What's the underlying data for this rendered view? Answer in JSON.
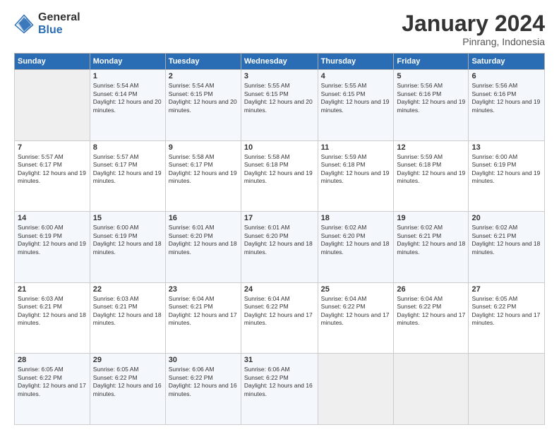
{
  "header": {
    "logo_general": "General",
    "logo_blue": "Blue",
    "month_year": "January 2024",
    "location": "Pinrang, Indonesia"
  },
  "columns": [
    "Sunday",
    "Monday",
    "Tuesday",
    "Wednesday",
    "Thursday",
    "Friday",
    "Saturday"
  ],
  "weeks": [
    [
      {
        "day": "",
        "sunrise": "",
        "sunset": "",
        "daylight": ""
      },
      {
        "day": "1",
        "sunrise": "Sunrise: 5:54 AM",
        "sunset": "Sunset: 6:14 PM",
        "daylight": "Daylight: 12 hours and 20 minutes."
      },
      {
        "day": "2",
        "sunrise": "Sunrise: 5:54 AM",
        "sunset": "Sunset: 6:15 PM",
        "daylight": "Daylight: 12 hours and 20 minutes."
      },
      {
        "day": "3",
        "sunrise": "Sunrise: 5:55 AM",
        "sunset": "Sunset: 6:15 PM",
        "daylight": "Daylight: 12 hours and 20 minutes."
      },
      {
        "day": "4",
        "sunrise": "Sunrise: 5:55 AM",
        "sunset": "Sunset: 6:15 PM",
        "daylight": "Daylight: 12 hours and 19 minutes."
      },
      {
        "day": "5",
        "sunrise": "Sunrise: 5:56 AM",
        "sunset": "Sunset: 6:16 PM",
        "daylight": "Daylight: 12 hours and 19 minutes."
      },
      {
        "day": "6",
        "sunrise": "Sunrise: 5:56 AM",
        "sunset": "Sunset: 6:16 PM",
        "daylight": "Daylight: 12 hours and 19 minutes."
      }
    ],
    [
      {
        "day": "7",
        "sunrise": "Sunrise: 5:57 AM",
        "sunset": "Sunset: 6:17 PM",
        "daylight": "Daylight: 12 hours and 19 minutes."
      },
      {
        "day": "8",
        "sunrise": "Sunrise: 5:57 AM",
        "sunset": "Sunset: 6:17 PM",
        "daylight": "Daylight: 12 hours and 19 minutes."
      },
      {
        "day": "9",
        "sunrise": "Sunrise: 5:58 AM",
        "sunset": "Sunset: 6:17 PM",
        "daylight": "Daylight: 12 hours and 19 minutes."
      },
      {
        "day": "10",
        "sunrise": "Sunrise: 5:58 AM",
        "sunset": "Sunset: 6:18 PM",
        "daylight": "Daylight: 12 hours and 19 minutes."
      },
      {
        "day": "11",
        "sunrise": "Sunrise: 5:59 AM",
        "sunset": "Sunset: 6:18 PM",
        "daylight": "Daylight: 12 hours and 19 minutes."
      },
      {
        "day": "12",
        "sunrise": "Sunrise: 5:59 AM",
        "sunset": "Sunset: 6:18 PM",
        "daylight": "Daylight: 12 hours and 19 minutes."
      },
      {
        "day": "13",
        "sunrise": "Sunrise: 6:00 AM",
        "sunset": "Sunset: 6:19 PM",
        "daylight": "Daylight: 12 hours and 19 minutes."
      }
    ],
    [
      {
        "day": "14",
        "sunrise": "Sunrise: 6:00 AM",
        "sunset": "Sunset: 6:19 PM",
        "daylight": "Daylight: 12 hours and 19 minutes."
      },
      {
        "day": "15",
        "sunrise": "Sunrise: 6:00 AM",
        "sunset": "Sunset: 6:19 PM",
        "daylight": "Daylight: 12 hours and 18 minutes."
      },
      {
        "day": "16",
        "sunrise": "Sunrise: 6:01 AM",
        "sunset": "Sunset: 6:20 PM",
        "daylight": "Daylight: 12 hours and 18 minutes."
      },
      {
        "day": "17",
        "sunrise": "Sunrise: 6:01 AM",
        "sunset": "Sunset: 6:20 PM",
        "daylight": "Daylight: 12 hours and 18 minutes."
      },
      {
        "day": "18",
        "sunrise": "Sunrise: 6:02 AM",
        "sunset": "Sunset: 6:20 PM",
        "daylight": "Daylight: 12 hours and 18 minutes."
      },
      {
        "day": "19",
        "sunrise": "Sunrise: 6:02 AM",
        "sunset": "Sunset: 6:21 PM",
        "daylight": "Daylight: 12 hours and 18 minutes."
      },
      {
        "day": "20",
        "sunrise": "Sunrise: 6:02 AM",
        "sunset": "Sunset: 6:21 PM",
        "daylight": "Daylight: 12 hours and 18 minutes."
      }
    ],
    [
      {
        "day": "21",
        "sunrise": "Sunrise: 6:03 AM",
        "sunset": "Sunset: 6:21 PM",
        "daylight": "Daylight: 12 hours and 18 minutes."
      },
      {
        "day": "22",
        "sunrise": "Sunrise: 6:03 AM",
        "sunset": "Sunset: 6:21 PM",
        "daylight": "Daylight: 12 hours and 18 minutes."
      },
      {
        "day": "23",
        "sunrise": "Sunrise: 6:04 AM",
        "sunset": "Sunset: 6:21 PM",
        "daylight": "Daylight: 12 hours and 17 minutes."
      },
      {
        "day": "24",
        "sunrise": "Sunrise: 6:04 AM",
        "sunset": "Sunset: 6:22 PM",
        "daylight": "Daylight: 12 hours and 17 minutes."
      },
      {
        "day": "25",
        "sunrise": "Sunrise: 6:04 AM",
        "sunset": "Sunset: 6:22 PM",
        "daylight": "Daylight: 12 hours and 17 minutes."
      },
      {
        "day": "26",
        "sunrise": "Sunrise: 6:04 AM",
        "sunset": "Sunset: 6:22 PM",
        "daylight": "Daylight: 12 hours and 17 minutes."
      },
      {
        "day": "27",
        "sunrise": "Sunrise: 6:05 AM",
        "sunset": "Sunset: 6:22 PM",
        "daylight": "Daylight: 12 hours and 17 minutes."
      }
    ],
    [
      {
        "day": "28",
        "sunrise": "Sunrise: 6:05 AM",
        "sunset": "Sunset: 6:22 PM",
        "daylight": "Daylight: 12 hours and 17 minutes."
      },
      {
        "day": "29",
        "sunrise": "Sunrise: 6:05 AM",
        "sunset": "Sunset: 6:22 PM",
        "daylight": "Daylight: 12 hours and 16 minutes."
      },
      {
        "day": "30",
        "sunrise": "Sunrise: 6:06 AM",
        "sunset": "Sunset: 6:22 PM",
        "daylight": "Daylight: 12 hours and 16 minutes."
      },
      {
        "day": "31",
        "sunrise": "Sunrise: 6:06 AM",
        "sunset": "Sunset: 6:22 PM",
        "daylight": "Daylight: 12 hours and 16 minutes."
      },
      {
        "day": "",
        "sunrise": "",
        "sunset": "",
        "daylight": ""
      },
      {
        "day": "",
        "sunrise": "",
        "sunset": "",
        "daylight": ""
      },
      {
        "day": "",
        "sunrise": "",
        "sunset": "",
        "daylight": ""
      }
    ]
  ]
}
